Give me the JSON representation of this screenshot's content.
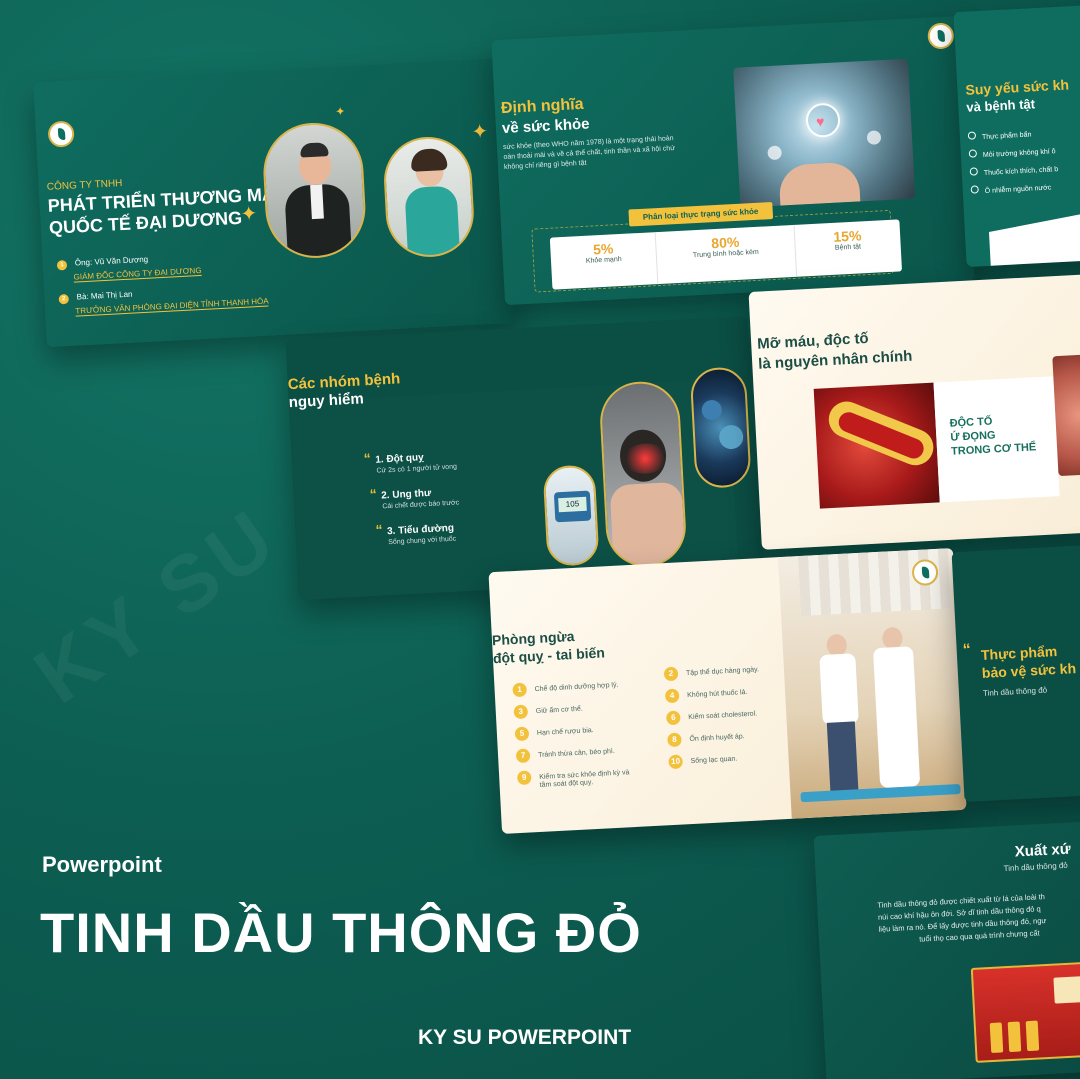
{
  "hero": {
    "eyebrow": "Powerpoint",
    "title": "TINH DẦU THÔNG ĐỎ",
    "footer": "KY SU POWERPOINT"
  },
  "slide1": {
    "company_line1": "CÔNG TY TNHH",
    "company_line2": "PHÁT TRIỂN THƯƠNG MẠI",
    "company_line3": "QUỐC TẾ ĐẠI DƯƠNG",
    "person1_name": "Ông: Vũ Văn Dương",
    "person1_role": "GIÁM ĐỐC CÔNG TY ĐẠI DƯƠNG",
    "person2_name": "Bà: Mai Thị Lan",
    "person2_role": "TRƯỞNG VĂN PHÒNG ĐẠI DIỆN TỈNH THANH HÓA"
  },
  "slide2": {
    "title1": "Định nghĩa",
    "title2": "về sức khỏe",
    "body1": "sức khỏe (theo WHO năm 1978) là một trạng thái hoàn",
    "body2": "oàn thoải mái và về cả thể chất, tinh thần và xã hội chứ",
    "body3": "không chỉ riêng gì bệnh tật",
    "banner": "Phân loại thực trạng sức khỏe",
    "stats": [
      {
        "value": "5%",
        "label": "Khỏe mạnh"
      },
      {
        "value": "80%",
        "label": "Trung bình hoặc kém"
      },
      {
        "value": "15%",
        "label": "Bệnh tật"
      }
    ]
  },
  "slide3": {
    "title1": "Suy yếu sức kh",
    "title2": "và bệnh tật",
    "items": [
      "Thực phẩm bẩn",
      "Môi trường không khí ô",
      "Thuốc kích thích, chất b",
      "Ô nhiễm nguồn nước"
    ]
  },
  "slide4": {
    "title1": "Các nhóm bệnh",
    "title2": "nguy hiểm",
    "items": [
      {
        "title": "1. Đột quỵ",
        "sub": "Cứ 2s có 1 người tử vong"
      },
      {
        "title": "2. Ung thư",
        "sub": "Cái chết được báo trước"
      },
      {
        "title": "3. Tiểu đường",
        "sub": "Sống chung với thuốc"
      }
    ],
    "meter_reading": "105"
  },
  "slide5": {
    "title1": "Mỡ máu, độc tố",
    "title2": "là nguyên nhân chính",
    "callout1": "ĐỘC TỐ",
    "callout2": "Ứ ĐỌNG",
    "callout3": "TRONG CƠ THỂ"
  },
  "slide6": {
    "title1": "Phòng ngừa",
    "title2": "đột quỵ - tai biến",
    "left": [
      {
        "n": "1",
        "t": "Chế độ dinh dưỡng hợp lý."
      },
      {
        "n": "3",
        "t": "Giữ ấm cơ thể."
      },
      {
        "n": "5",
        "t": "Hạn chế rượu bia."
      },
      {
        "n": "7",
        "t": "Tránh thừa cân, béo phì."
      },
      {
        "n": "9",
        "t": "Kiểm tra sức khỏe định kỳ và"
      }
    ],
    "left_extra": "tầm soát đột quỵ.",
    "right": [
      {
        "n": "2",
        "t": "Tập thể dục hàng ngày."
      },
      {
        "n": "4",
        "t": "Không hút thuốc lá."
      },
      {
        "n": "6",
        "t": "Kiểm soát cholesterol."
      },
      {
        "n": "8",
        "t": "Ổn định huyết áp."
      },
      {
        "n": "10",
        "t": "Sống lạc quan."
      }
    ]
  },
  "slide7": {
    "title1": "Thực phẩm",
    "title2": "bảo vệ sức kh",
    "sub": "Tinh dầu thông đỏ"
  },
  "slide8": {
    "title": "Xuất xứ",
    "sub": "Tinh dầu thông đỏ",
    "body1": "Tinh dầu thông đỏ được chiết xuất từ lá của loài th",
    "body2": "núi cao khí hậu ôn đới. Sở dĩ tinh dầu thông đỏ q",
    "body3": "liệu làm ra nó. Để lấy được tinh dầu thông đỏ, ngư",
    "body4": "tuổi thọ cao qua quá trình chưng cất"
  },
  "colors": {
    "background": "#0d5f53",
    "gold": "#f3c23d",
    "cream": "#fbf2e2"
  }
}
